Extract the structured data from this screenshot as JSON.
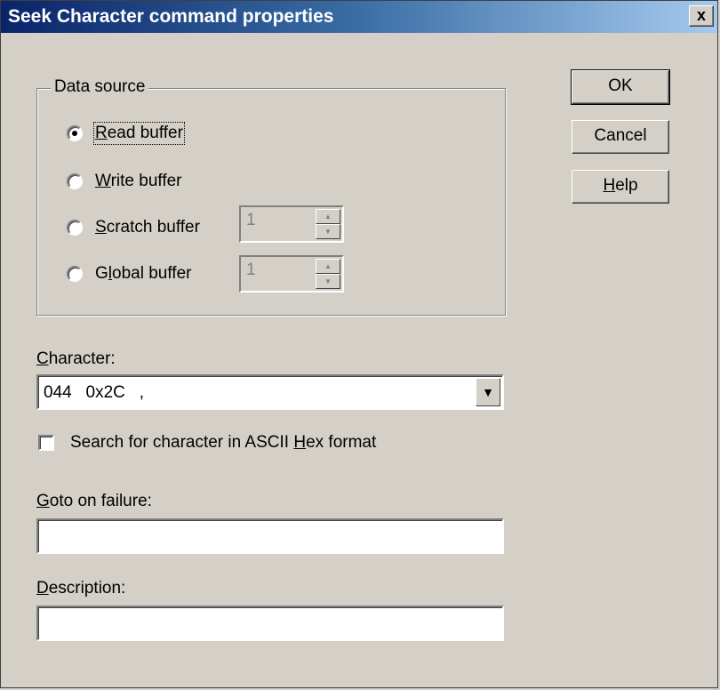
{
  "window": {
    "title": "Seek Character command properties",
    "close_label": "x"
  },
  "data_source": {
    "legend": "Data source",
    "options": [
      {
        "first": "R",
        "rest": "ead buffer",
        "selected": true
      },
      {
        "first": "W",
        "rest": "rite buffer",
        "selected": false
      },
      {
        "first": "S",
        "rest": "cratch buffer",
        "selected": false,
        "spin_value": "1"
      },
      {
        "prefix": "G",
        "first": "l",
        "rest": "obal buffer",
        "selected": false,
        "spin_value": "1"
      }
    ]
  },
  "character": {
    "label_first": "C",
    "label_rest": "haracter:",
    "value": "044   0x2C   ,"
  },
  "hex_checkbox": {
    "label_pre": "Search for character in ASCII ",
    "label_accel": "H",
    "label_post": "ex format",
    "checked": false
  },
  "goto_failure": {
    "label_first": "G",
    "label_rest": "oto on failure:",
    "value": ""
  },
  "description": {
    "label_first": "D",
    "label_rest": "escription:",
    "value": ""
  },
  "buttons": {
    "ok": "OK",
    "cancel": "Cancel",
    "help_first": "H",
    "help_rest": "elp"
  }
}
